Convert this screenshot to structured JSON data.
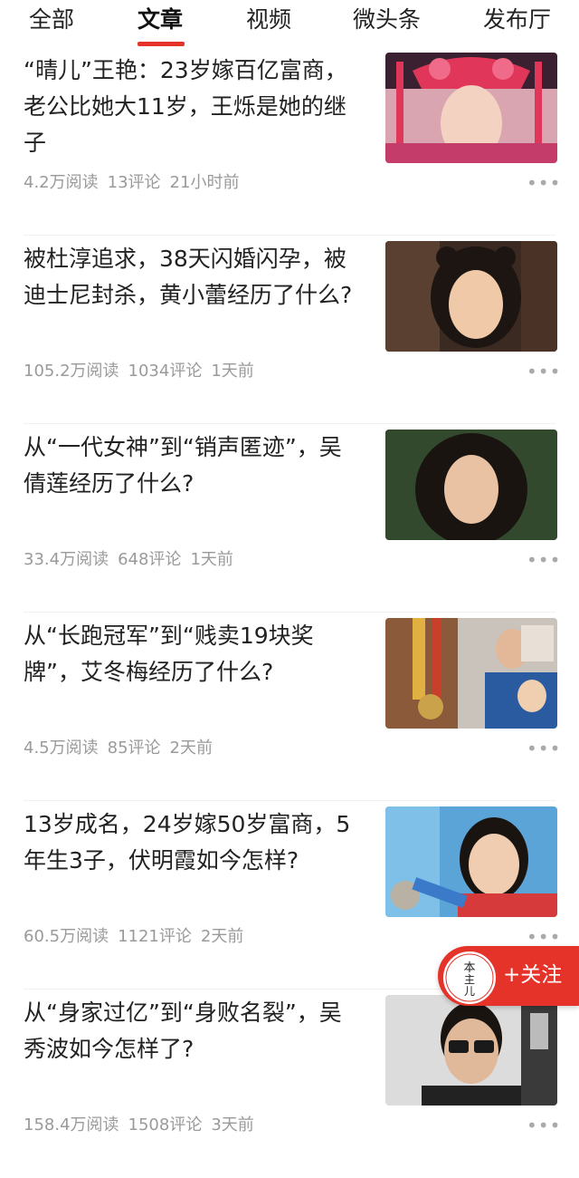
{
  "tabs": [
    {
      "label": "全部",
      "active": false
    },
    {
      "label": "文章",
      "active": true
    },
    {
      "label": "视频",
      "active": false
    },
    {
      "label": "微头条",
      "active": false
    },
    {
      "label": "发布厅",
      "active": false
    }
  ],
  "articles": [
    {
      "title": "“晴儿”王艳：23岁嫁百亿富商，老公比她大11岁，王烁是她的继子",
      "reads": "4.2万阅读",
      "comments": "13评论",
      "time": "21小时前"
    },
    {
      "title": "被杜淳追求，38天闪婚闪孕，被迪士尼封杀，黄小蕾经历了什么?",
      "reads": "105.2万阅读",
      "comments": "1034评论",
      "time": "1天前"
    },
    {
      "title": "从“一代女神”到“销声匿迹”，吴倩莲经历了什么?",
      "reads": "33.4万阅读",
      "comments": "648评论",
      "time": "1天前"
    },
    {
      "title": "从“长跑冠军”到“贱卖19块奖牌”，艾冬梅经历了什么?",
      "reads": "4.5万阅读",
      "comments": "85评论",
      "time": "2天前"
    },
    {
      "title": "13岁成名，24岁嫁50岁富商，5年生3子，伏明霞如今怎样?",
      "reads": "60.5万阅读",
      "comments": "1121评论",
      "time": "2天前"
    },
    {
      "title": "从“身家过亿”到“身败名裂”，吴秀波如今怎样了?",
      "reads": "158.4万阅读",
      "comments": "1508评论",
      "time": "3天前"
    }
  ],
  "more_icon": "ellipsis-icon",
  "follow": {
    "label": "+关注",
    "avatar_text": "本主儿"
  },
  "colors": {
    "accent": "#e6332a",
    "meta": "#9a9a9a"
  }
}
